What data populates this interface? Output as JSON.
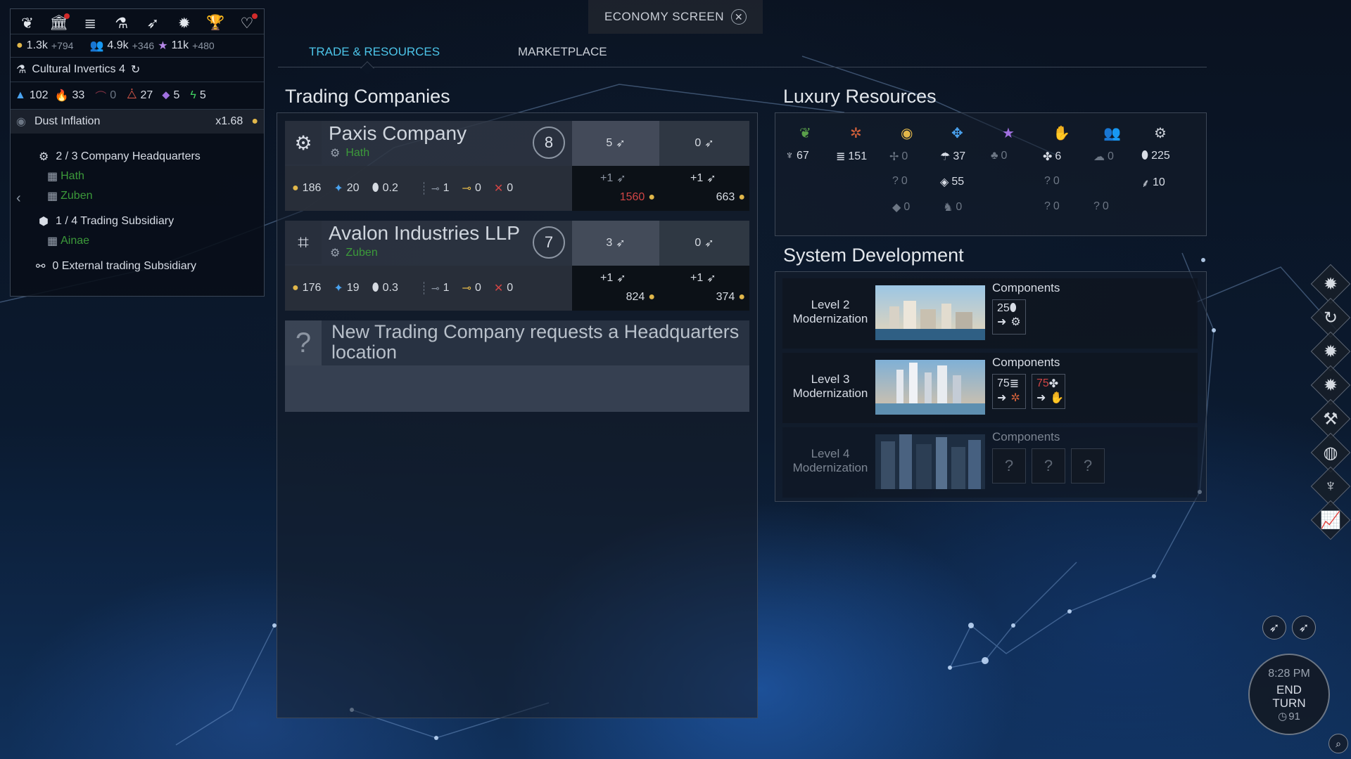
{
  "window": {
    "title": "ECONOMY SCREEN"
  },
  "tabs": [
    {
      "label": "TRADE & RESOURCES",
      "active": true
    },
    {
      "label": "MARKETPLACE",
      "active": false
    }
  ],
  "empire": {
    "dust": "1.3k",
    "dust_delta": "+794",
    "influence": "4.9k",
    "influence_delta": "+346",
    "science": "11k",
    "science_delta": "+480",
    "status_name": "Cultural Invertics 4",
    "strategic": [
      "102",
      "33",
      "0",
      "27",
      "5",
      "5"
    ],
    "inflation_label": "Dust Inflation",
    "inflation_value": "x1.68",
    "hq_label": "2 / 3 Company Headquarters",
    "hq_systems": [
      "Hath",
      "Zuben"
    ],
    "subsidiary_label": "1 / 4 Trading Subsidiary",
    "subsidiary_systems": [
      "Ainae"
    ],
    "external_label": "0 External trading Subsidiary"
  },
  "trading": {
    "title": "Trading Companies",
    "companies": [
      {
        "name": "Paxis Company",
        "hq": "Hath",
        "level": "8",
        "ships": "5",
        "trade": "0",
        "dust": "186",
        "influence": "20",
        "ratio": "0.2",
        "routes": [
          "1",
          "0",
          "0"
        ],
        "col1_top": "+1",
        "col1_value": "1560",
        "col2_top": "+1",
        "col2_value": "663"
      },
      {
        "name": "Avalon Industries LLP",
        "hq": "Zuben",
        "level": "7",
        "ships": "3",
        "trade": "0",
        "dust": "176",
        "influence": "19",
        "ratio": "0.3",
        "routes": [
          "1",
          "0",
          "0"
        ],
        "col1_top": "+1",
        "col1_value": "824",
        "col2_top": "+1",
        "col2_value": "374"
      }
    ],
    "new_company": {
      "mark": "?",
      "text": "New Trading Company requests a Headquarters location"
    }
  },
  "luxury": {
    "title": "Luxury Resources",
    "cells": [
      [
        "67",
        "151",
        "0",
        "37",
        "0",
        "6",
        "0",
        "225"
      ],
      [
        "",
        "",
        "0",
        "55",
        "",
        "0",
        "",
        "10"
      ],
      [
        "",
        "",
        "0",
        "0",
        "",
        "0",
        "0",
        ""
      ]
    ],
    "marks": [
      "?",
      "?",
      "?"
    ]
  },
  "development": {
    "title": "System Development",
    "components_label": "Components",
    "levels": [
      {
        "label": "Level 2 Modernization",
        "components": [
          "25"
        ]
      },
      {
        "label": "Level 3 Modernization",
        "components": [
          "75",
          "75"
        ]
      },
      {
        "label": "Level 4 Modernization",
        "components": [
          "?",
          "?",
          "?"
        ]
      }
    ]
  },
  "clock": {
    "time": "8:28 PM",
    "end_turn": "END TURN",
    "turn": "91"
  },
  "colors": {
    "accent": "#4cc4e8",
    "gold": "#e1b74a",
    "green": "#3c9a3a",
    "red": "#d04545",
    "pink": "#e04cc0"
  }
}
